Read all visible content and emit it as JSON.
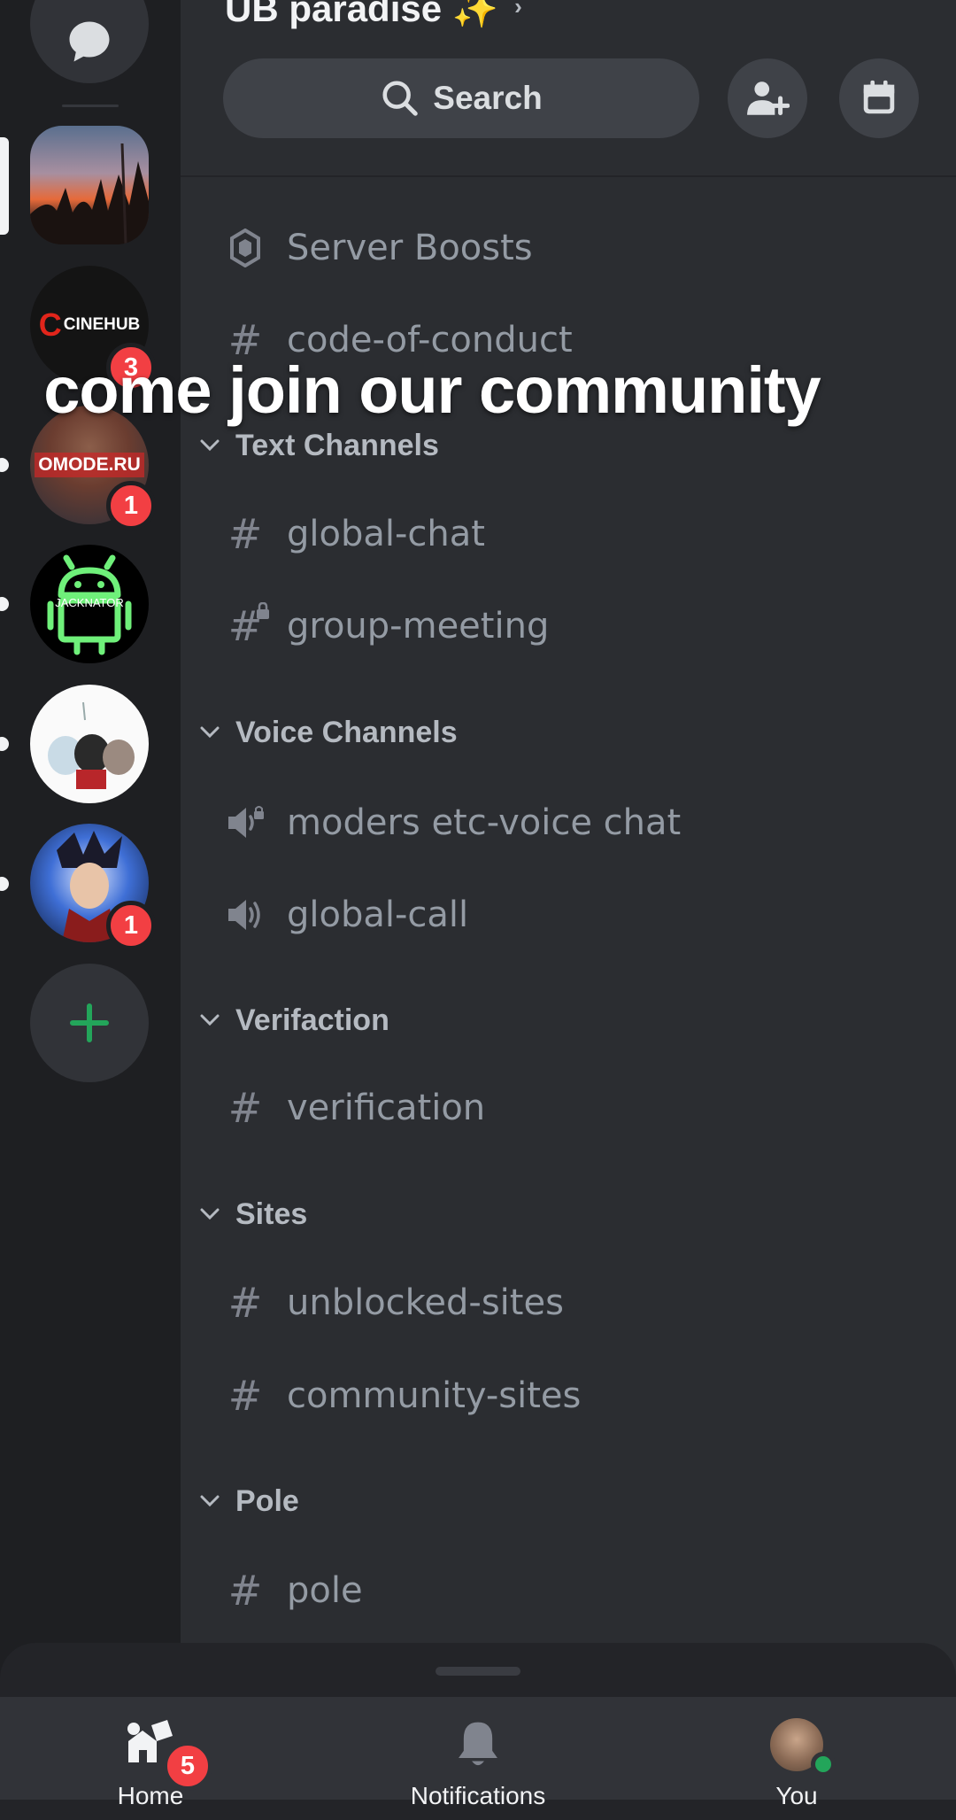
{
  "server": {
    "name": "UB paradise ✨",
    "chevron": "›"
  },
  "search": {
    "label": "Search",
    "icon": "search-icon"
  },
  "header_buttons": [
    {
      "name": "invite-members-button",
      "icon": "add-user-icon"
    },
    {
      "name": "events-button",
      "icon": "calendar-icon"
    }
  ],
  "overlay_caption": "come join our community",
  "rail": {
    "cinehub_label": "CINEHUB",
    "omode_label": "OMODE.RU",
    "jacknator_label": "JACKNATOR",
    "badges": {
      "cinehub": "3",
      "omode": "1",
      "anime": "1"
    }
  },
  "channels": {
    "server_boosts": "Server Boosts",
    "code_of_conduct": "code-of-conduct",
    "cat_text": "Text Channels",
    "global_chat": "global-chat",
    "group_meeting": "group-meeting",
    "cat_voice": "Voice Channels",
    "moders_voice": "moders etc-voice chat",
    "global_call": "global-call",
    "cat_verifaction": "Verifaction",
    "verification": "verification",
    "cat_sites": "Sites",
    "unblocked_sites": "unblocked-sites",
    "community_sites": "community-sites",
    "cat_pole": "Pole",
    "pole": "pole"
  },
  "bottom_nav": {
    "home": "Home",
    "home_badge": "5",
    "notifications": "Notifications",
    "you": "You"
  },
  "colors": {
    "accent_green": "#23a55a",
    "badge_red": "#f23f43",
    "panel": "#2b2d31",
    "rail": "#1e1f22"
  }
}
